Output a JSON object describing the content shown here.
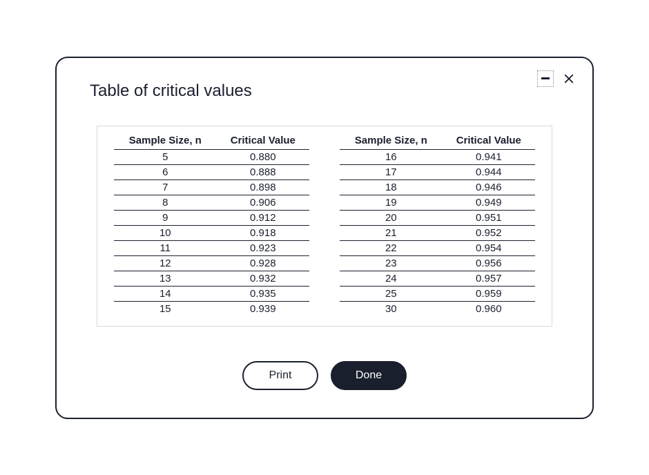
{
  "title": "Table of critical values",
  "headers": {
    "sample": "Sample Size, n",
    "critical": "Critical Value"
  },
  "left": [
    {
      "n": "5",
      "v": "0.880"
    },
    {
      "n": "6",
      "v": "0.888"
    },
    {
      "n": "7",
      "v": "0.898"
    },
    {
      "n": "8",
      "v": "0.906"
    },
    {
      "n": "9",
      "v": "0.912"
    },
    {
      "n": "10",
      "v": "0.918"
    },
    {
      "n": "11",
      "v": "0.923"
    },
    {
      "n": "12",
      "v": "0.928"
    },
    {
      "n": "13",
      "v": "0.932"
    },
    {
      "n": "14",
      "v": "0.935"
    },
    {
      "n": "15",
      "v": "0.939"
    }
  ],
  "right": [
    {
      "n": "16",
      "v": "0.941"
    },
    {
      "n": "17",
      "v": "0.944"
    },
    {
      "n": "18",
      "v": "0.946"
    },
    {
      "n": "19",
      "v": "0.949"
    },
    {
      "n": "20",
      "v": "0.951"
    },
    {
      "n": "21",
      "v": "0.952"
    },
    {
      "n": "22",
      "v": "0.954"
    },
    {
      "n": "23",
      "v": "0.956"
    },
    {
      "n": "24",
      "v": "0.957"
    },
    {
      "n": "25",
      "v": "0.959"
    },
    {
      "n": "30",
      "v": "0.960"
    }
  ],
  "buttons": {
    "print": "Print",
    "done": "Done"
  },
  "chart_data": {
    "type": "table",
    "title": "Table of critical values",
    "columns": [
      "Sample Size, n",
      "Critical Value"
    ],
    "rows": [
      [
        5,
        0.88
      ],
      [
        6,
        0.888
      ],
      [
        7,
        0.898
      ],
      [
        8,
        0.906
      ],
      [
        9,
        0.912
      ],
      [
        10,
        0.918
      ],
      [
        11,
        0.923
      ],
      [
        12,
        0.928
      ],
      [
        13,
        0.932
      ],
      [
        14,
        0.935
      ],
      [
        15,
        0.939
      ],
      [
        16,
        0.941
      ],
      [
        17,
        0.944
      ],
      [
        18,
        0.946
      ],
      [
        19,
        0.949
      ],
      [
        20,
        0.951
      ],
      [
        21,
        0.952
      ],
      [
        22,
        0.954
      ],
      [
        23,
        0.956
      ],
      [
        24,
        0.957
      ],
      [
        25,
        0.959
      ],
      [
        30,
        0.96
      ]
    ]
  }
}
